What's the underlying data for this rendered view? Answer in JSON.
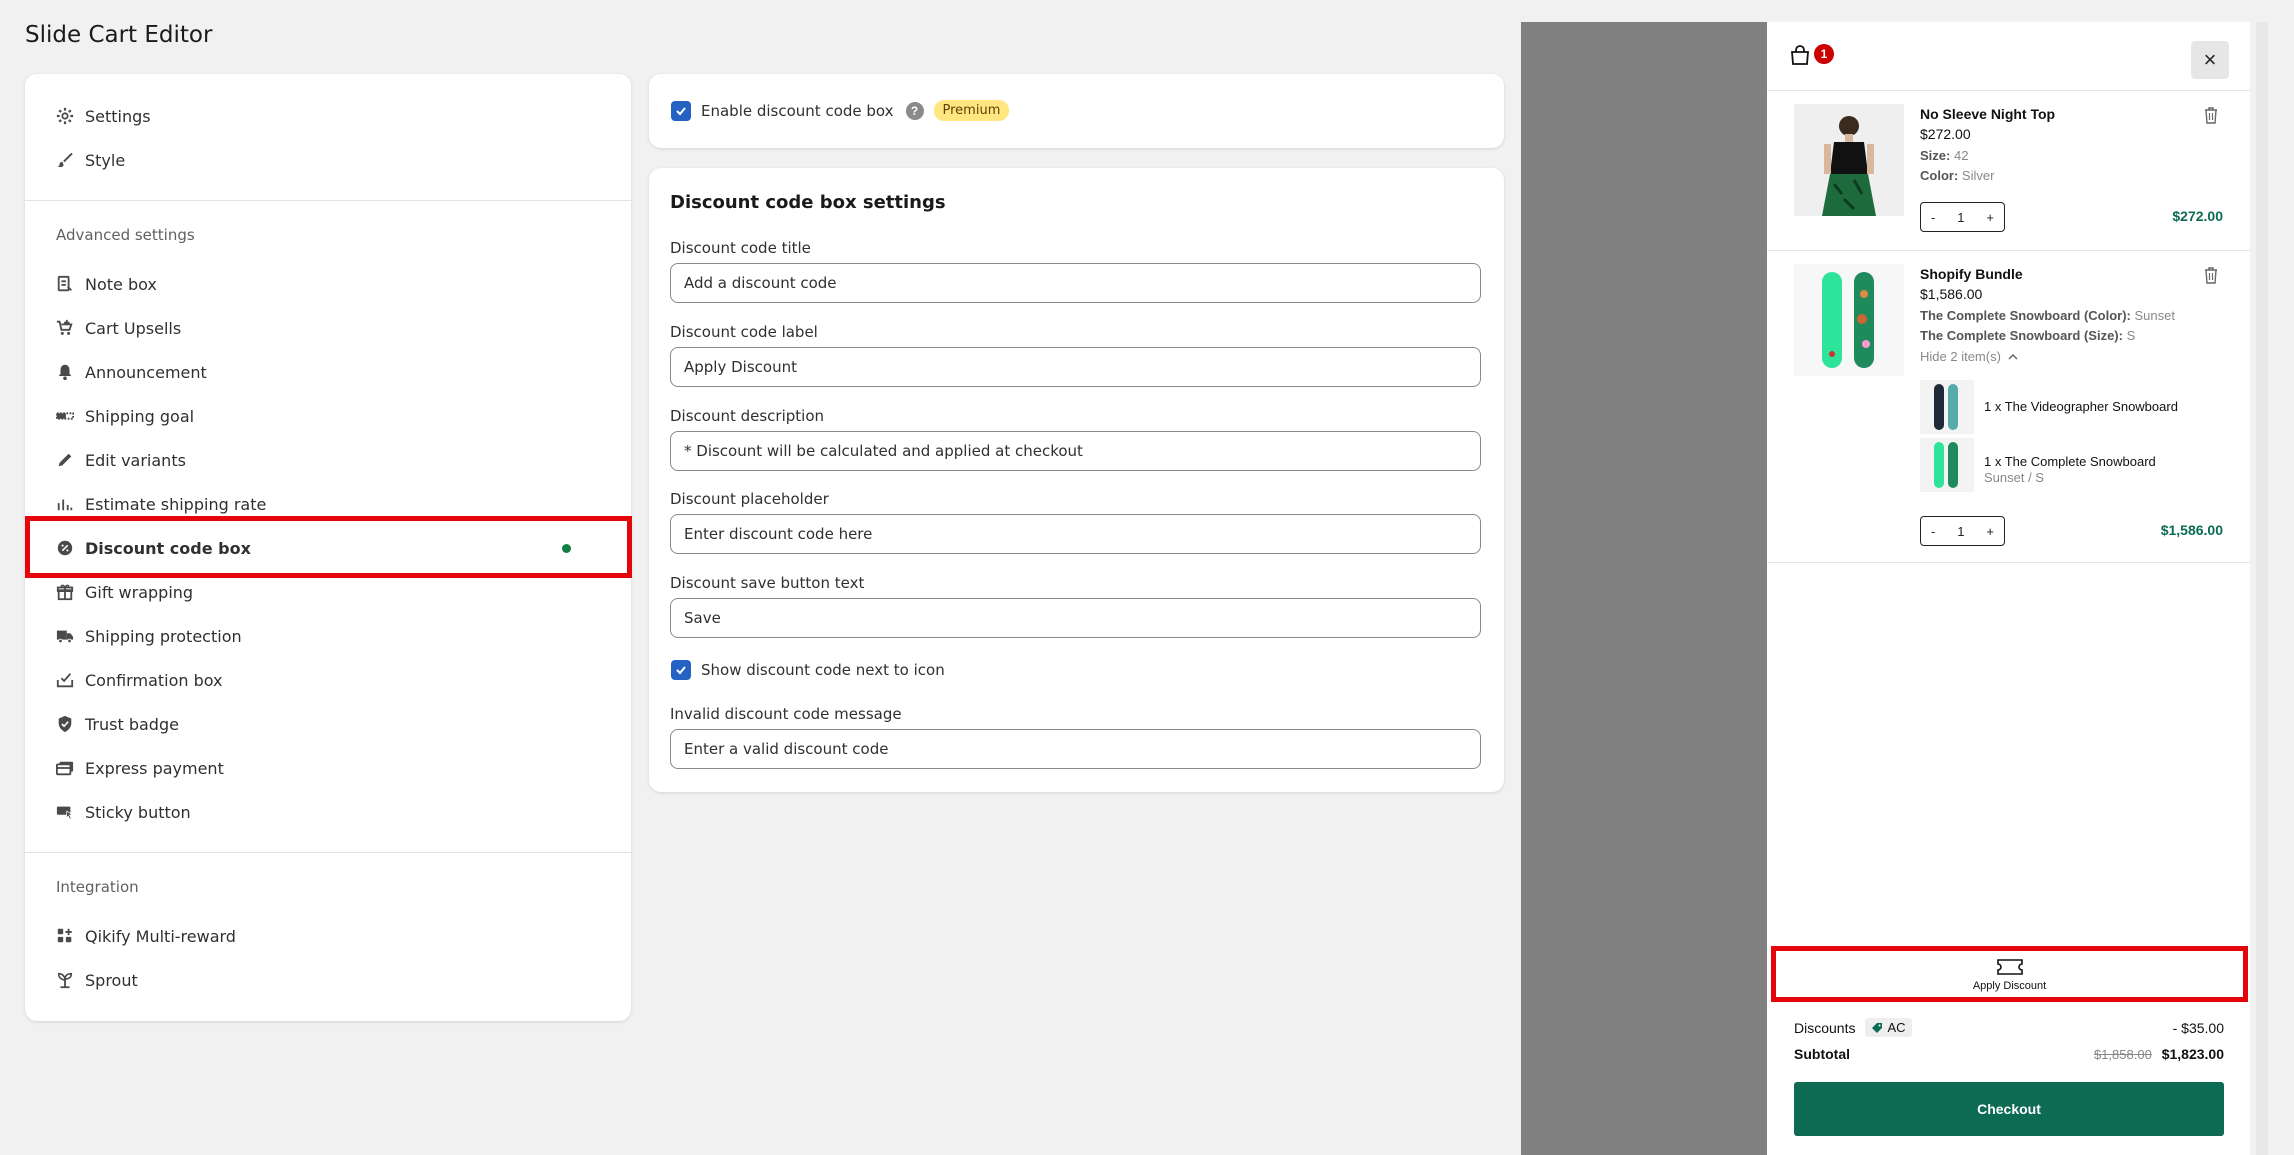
{
  "app": {
    "title": "Slide Cart Editor"
  },
  "sidebar": {
    "top_items": [
      {
        "label": "Settings",
        "icon": "gear-icon"
      },
      {
        "label": "Style",
        "icon": "brush-icon"
      }
    ],
    "advanced_title": "Advanced settings",
    "advanced_items": [
      {
        "label": "Note box",
        "icon": "note-icon"
      },
      {
        "label": "Cart Upsells",
        "icon": "cart-upsell-icon"
      },
      {
        "label": "Announcement",
        "icon": "bell-icon"
      },
      {
        "label": "Shipping goal",
        "icon": "progress-bar-icon"
      },
      {
        "label": "Edit variants",
        "icon": "pencil-icon"
      },
      {
        "label": "Estimate shipping rate",
        "icon": "bar-chart-icon"
      },
      {
        "label": "Discount code box",
        "icon": "discount-icon",
        "active": true
      },
      {
        "label": "Gift wrapping",
        "icon": "gift-icon"
      },
      {
        "label": "Shipping protection",
        "icon": "truck-icon"
      },
      {
        "label": "Confirmation box",
        "icon": "checkbox-tray-icon"
      },
      {
        "label": "Trust badge",
        "icon": "shield-check-icon"
      },
      {
        "label": "Express payment",
        "icon": "credit-card-icon"
      },
      {
        "label": "Sticky button",
        "icon": "sticky-button-icon"
      }
    ],
    "integration_title": "Integration",
    "integration_items": [
      {
        "label": "Qikify Multi-reward",
        "icon": "apps-icon"
      },
      {
        "label": "Sprout",
        "icon": "sprout-icon"
      }
    ]
  },
  "enable_panel": {
    "label": "Enable discount code box",
    "checked": true,
    "help": "?",
    "badge": "Premium"
  },
  "settings_panel": {
    "title": "Discount code box settings",
    "fields": [
      {
        "label": "Discount code title",
        "value": "Add a discount code"
      },
      {
        "label": "Discount code label",
        "value": "Apply Discount"
      },
      {
        "label": "Discount description",
        "value": "* Discount will be calculated and applied at checkout"
      },
      {
        "label": "Discount placeholder",
        "value": "Enter discount code here"
      },
      {
        "label": "Discount save button text",
        "value": "Save"
      }
    ],
    "show_code_checkbox": {
      "label": "Show discount code next to icon",
      "checked": true
    },
    "invalid_field": {
      "label": "Invalid discount code message",
      "value": "Enter a valid discount code"
    }
  },
  "cart": {
    "badge_count": "1",
    "close": "×",
    "items": [
      {
        "title": "No Sleeve Night Top",
        "price": "$272.00",
        "options": [
          {
            "name": "Size:",
            "value": "42"
          },
          {
            "name": "Color:",
            "value": "Silver"
          }
        ],
        "qty": "1",
        "line_price": "$272.00"
      },
      {
        "title": "Shopify Bundle",
        "price": "$1,586.00",
        "options": [
          {
            "name": "The Complete Snowboard (Color):",
            "value": "Sunset"
          },
          {
            "name": "The Complete Snowboard (Size):",
            "value": "S"
          }
        ],
        "toggle": "Hide 2 item(s)",
        "children": [
          {
            "title": "1 x The Videographer Snowboard",
            "sub": ""
          },
          {
            "title": "1 x The Complete Snowboard",
            "sub": "Sunset / S"
          }
        ],
        "qty": "1",
        "line_price": "$1,586.00"
      }
    ],
    "apply_discount_label": "Apply Discount",
    "discounts_label": "Discounts",
    "discount_code": "AC",
    "discount_amount": "- $35.00",
    "subtotal_label": "Subtotal",
    "subtotal_original": "$1,858.00",
    "subtotal_final": "$1,823.00",
    "checkout_label": "Checkout",
    "qty_minus": "-",
    "qty_plus": "+"
  },
  "colors": {
    "accent_blue": "#2463c4",
    "checkout_green": "#0c6b52",
    "highlight_red": "#e4060b",
    "status_dot": "#108043"
  }
}
